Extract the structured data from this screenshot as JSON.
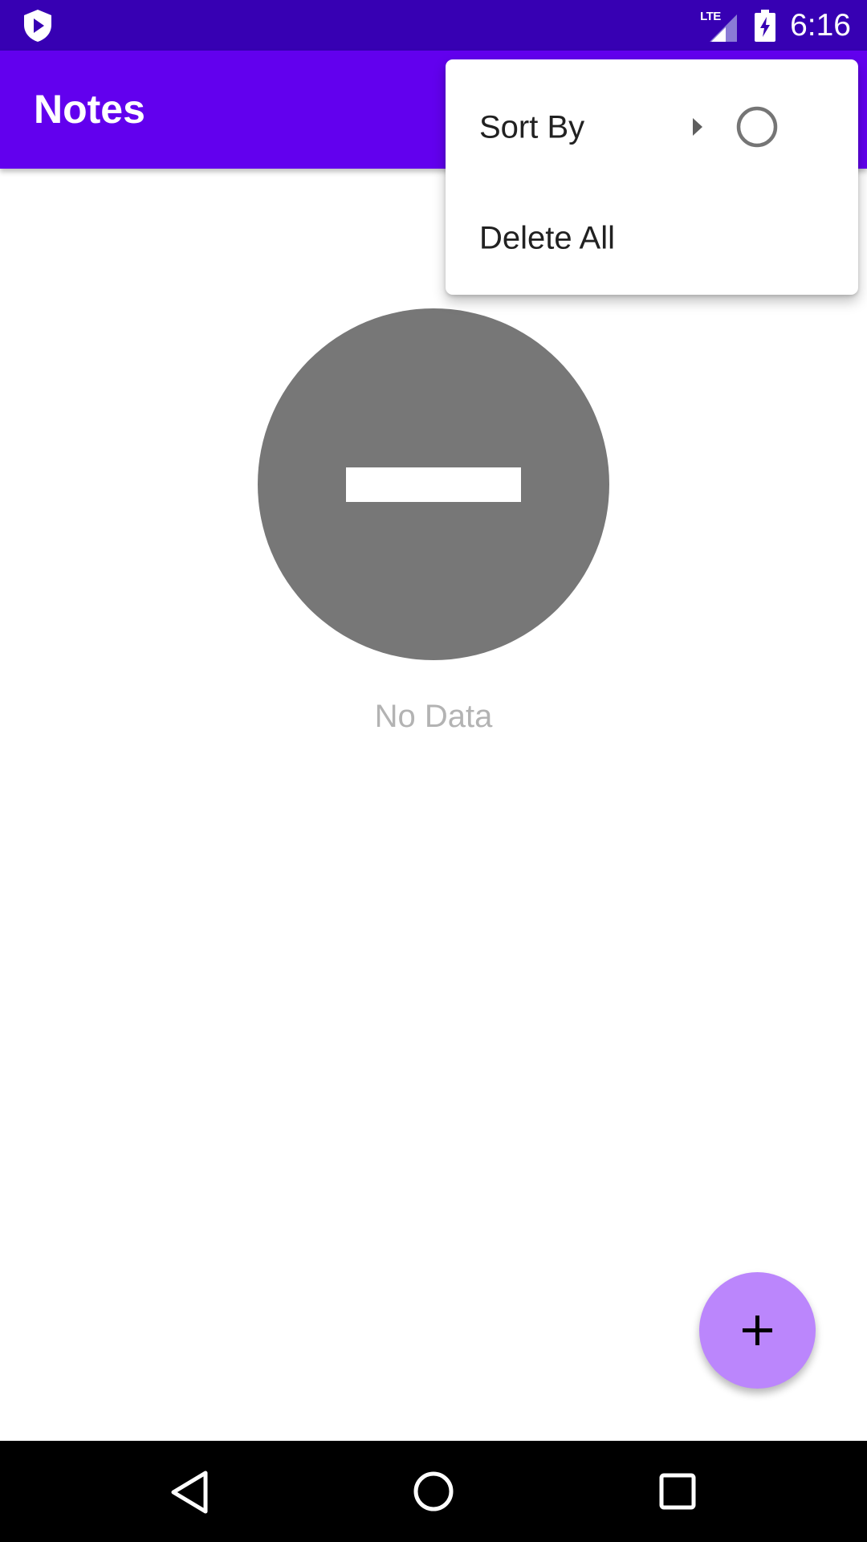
{
  "status_bar": {
    "network_label": "LTE",
    "time": "6:16",
    "icons": [
      "shield-play-icon",
      "signal-icon",
      "battery-charging-icon"
    ]
  },
  "app_bar": {
    "title": "Notes"
  },
  "overflow_menu": {
    "items": [
      {
        "label": "Sort By",
        "has_submenu": true,
        "radio_selected": false
      },
      {
        "label": "Delete All"
      }
    ]
  },
  "empty_state": {
    "icon": "no-entry-icon",
    "message": "No Data"
  },
  "fab": {
    "icon": "plus-icon"
  },
  "nav_bar": {
    "buttons": [
      "back-icon",
      "home-icon",
      "recents-icon"
    ]
  },
  "colors": {
    "status_bar": "#3700b3",
    "app_bar": "#6200ee",
    "fab": "#bb86fc",
    "empty_icon": "#777777",
    "empty_text": "#b3b3b3"
  }
}
